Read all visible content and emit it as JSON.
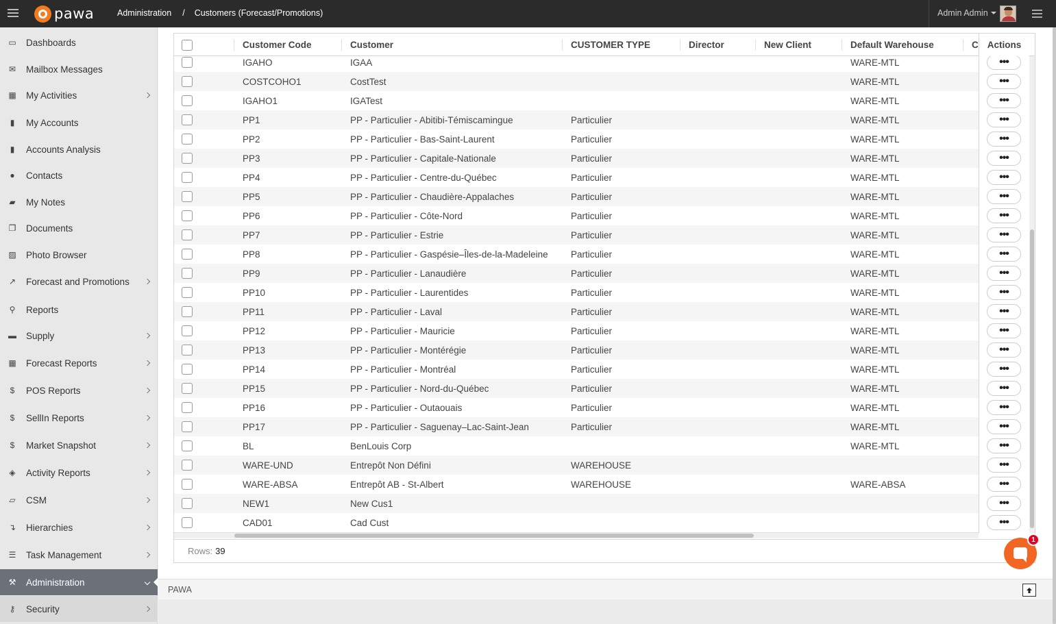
{
  "app": {
    "logo_text": "pawa",
    "brand_color": "#f47b20"
  },
  "breadcrumb": {
    "items": [
      "Administration",
      "Customers (Forecast/Promotions)"
    ],
    "separator": "/"
  },
  "user": {
    "name": "Admin Admin"
  },
  "sidebar": {
    "items": [
      {
        "label": "Dashboards",
        "icon": "monitor-icon",
        "chevron": false
      },
      {
        "label": "Mailbox Messages",
        "icon": "envelope-icon",
        "chevron": false
      },
      {
        "label": "My Activities",
        "icon": "calendar-icon",
        "chevron": true
      },
      {
        "label": "My Accounts",
        "icon": "building-icon",
        "chevron": false
      },
      {
        "label": "Accounts Analysis",
        "icon": "building-icon",
        "chevron": false
      },
      {
        "label": "Contacts",
        "icon": "user-icon",
        "chevron": false
      },
      {
        "label": "My Notes",
        "icon": "note-icon",
        "chevron": false
      },
      {
        "label": "Documents",
        "icon": "copy-icon",
        "chevron": false
      },
      {
        "label": "Photo Browser",
        "icon": "image-icon",
        "chevron": false
      },
      {
        "label": "Forecast and Promotions",
        "icon": "line-chart-icon",
        "chevron": true
      },
      {
        "label": "Reports",
        "icon": "search-icon",
        "chevron": false
      },
      {
        "label": "Supply",
        "icon": "truck-icon",
        "chevron": true
      },
      {
        "label": "Forecast Reports",
        "icon": "table-icon",
        "chevron": true
      },
      {
        "label": "POS Reports",
        "icon": "dollar-icon",
        "chevron": true
      },
      {
        "label": "SellIn Reports",
        "icon": "dollar-icon",
        "chevron": true
      },
      {
        "label": "Market Snapshot",
        "icon": "dollar-icon",
        "chevron": true
      },
      {
        "label": "Activity Reports",
        "icon": "cube-icon",
        "chevron": true
      },
      {
        "label": "CSM",
        "icon": "book-icon",
        "chevron": true
      },
      {
        "label": "Hierarchies",
        "icon": "level-down-icon",
        "chevron": true
      },
      {
        "label": "Task Management",
        "icon": "tasks-icon",
        "chevron": true
      },
      {
        "label": "Administration",
        "icon": "wrench-icon",
        "chevron": true,
        "active": true
      },
      {
        "label": "Security",
        "icon": "key-icon",
        "chevron": true
      }
    ]
  },
  "grid": {
    "columns": [
      "Customer Code",
      "Customer",
      "CUSTOMER TYPE",
      "Director",
      "New Client",
      "Default Warehouse",
      "C"
    ],
    "actions_header": "Actions",
    "action_button_label": "•••",
    "rows": [
      [
        "IGAHO",
        "IGAA",
        "",
        "",
        "",
        "WARE-MTL"
      ],
      [
        "COSTCOHO1",
        "CostTest",
        "",
        "",
        "",
        "WARE-MTL"
      ],
      [
        "IGAHO1",
        "IGATest",
        "",
        "",
        "",
        "WARE-MTL"
      ],
      [
        "PP1",
        "PP - Particulier - Abitibi-Témiscamingue",
        "Particulier",
        "",
        "",
        "WARE-MTL"
      ],
      [
        "PP2",
        "PP - Particulier - Bas-Saint-Laurent",
        "Particulier",
        "",
        "",
        "WARE-MTL"
      ],
      [
        "PP3",
        "PP - Particulier - Capitale-Nationale",
        "Particulier",
        "",
        "",
        "WARE-MTL"
      ],
      [
        "PP4",
        "PP - Particulier - Centre-du-Québec",
        "Particulier",
        "",
        "",
        "WARE-MTL"
      ],
      [
        "PP5",
        "PP - Particulier - Chaudière-Appalaches",
        "Particulier",
        "",
        "",
        "WARE-MTL"
      ],
      [
        "PP6",
        "PP - Particulier - Côte-Nord",
        "Particulier",
        "",
        "",
        "WARE-MTL"
      ],
      [
        "PP7",
        "PP - Particulier - Estrie",
        "Particulier",
        "",
        "",
        "WARE-MTL"
      ],
      [
        "PP8",
        "PP - Particulier - Gaspésie–Îles-de-la-Madeleine",
        "Particulier",
        "",
        "",
        "WARE-MTL"
      ],
      [
        "PP9",
        "PP - Particulier - Lanaudière",
        "Particulier",
        "",
        "",
        "WARE-MTL"
      ],
      [
        "PP10",
        "PP - Particulier - Laurentides",
        "Particulier",
        "",
        "",
        "WARE-MTL"
      ],
      [
        "PP11",
        "PP - Particulier - Laval",
        "Particulier",
        "",
        "",
        "WARE-MTL"
      ],
      [
        "PP12",
        "PP - Particulier - Mauricie",
        "Particulier",
        "",
        "",
        "WARE-MTL"
      ],
      [
        "PP13",
        "PP - Particulier - Montérégie",
        "Particulier",
        "",
        "",
        "WARE-MTL"
      ],
      [
        "PP14",
        "PP - Particulier - Montréal",
        "Particulier",
        "",
        "",
        "WARE-MTL"
      ],
      [
        "PP15",
        "PP - Particulier - Nord-du-Québec",
        "Particulier",
        "",
        "",
        "WARE-MTL"
      ],
      [
        "PP16",
        "PP - Particulier - Outaouais",
        "Particulier",
        "",
        "",
        "WARE-MTL"
      ],
      [
        "PP17",
        "PP - Particulier - Saguenay–Lac-Saint-Jean",
        "Particulier",
        "",
        "",
        "WARE-MTL"
      ],
      [
        "BL",
        "BenLouis Corp",
        "",
        "",
        "",
        "WARE-MTL"
      ],
      [
        "WARE-UND",
        "Entrepôt Non Défini",
        "WAREHOUSE",
        "",
        "",
        ""
      ],
      [
        "WARE-ABSA",
        "Entrepôt AB - St-Albert",
        "WAREHOUSE",
        "",
        "",
        "WARE-ABSA"
      ],
      [
        "NEW1",
        "New Cus1",
        "",
        "",
        "",
        ""
      ],
      [
        "CAD01",
        "Cad Cust",
        "",
        "",
        "",
        ""
      ]
    ],
    "rows_label": "Rows:",
    "rows_count": "39"
  },
  "footer": {
    "brand": "PAWA"
  },
  "chat": {
    "badge": "1"
  }
}
